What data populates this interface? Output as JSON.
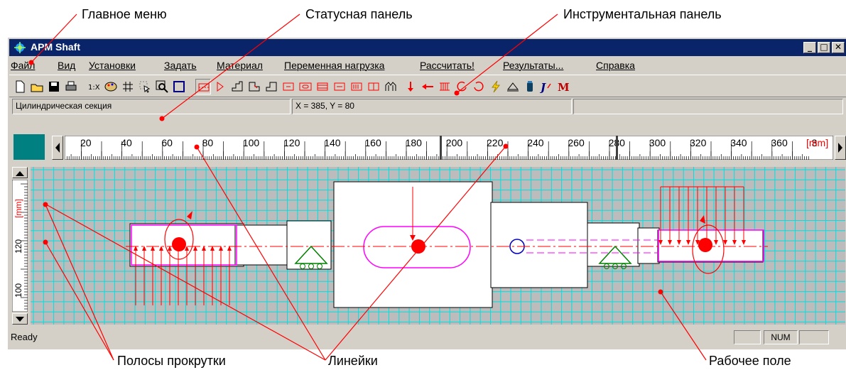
{
  "annotations": {
    "main_menu": "Главное меню",
    "status_panel": "Статусная панель",
    "toolbar": "Инструментальная панель",
    "scrollbars": "Полосы прокрутки",
    "rulers": "Линейки",
    "workspace": "Рабочее поле"
  },
  "window": {
    "title": "APM Shaft"
  },
  "menu": [
    "Файл",
    "Вид",
    "Установки",
    "Задать",
    "Материал",
    "Переменная нагрузка",
    "Рассчитать!",
    "Результаты...",
    "Справка"
  ],
  "toolbar_icons": [
    "new-file-icon",
    "open-folder-icon",
    "save-icon",
    "print-icon",
    "scale-1x-icon",
    "palette-icon",
    "grid-icon",
    "select-cursor-icon",
    "zoom-icon",
    "frame-icon",
    "cylinder-section-icon",
    "cone-section-icon",
    "step-left-icon",
    "step-right-icon",
    "step-both-icon",
    "groove-icon",
    "key-slot-icon",
    "spline-icon",
    "thread-icon",
    "gear-section-icon",
    "ring-icon",
    "pattern-icon",
    "force-down-icon",
    "force-left-icon",
    "distributed-load-icon",
    "moment-ccw-icon",
    "moment-cw-icon",
    "lightning-icon",
    "support-icon",
    "bearing-icon",
    "bending-icon",
    "mass-icon"
  ],
  "status": {
    "section": "Цилиндрическая секция",
    "coords": "X = 385, Y = 80"
  },
  "ruler": {
    "h_labels": [
      "20",
      "40",
      "60",
      "80",
      "100",
      "120",
      "140",
      "160",
      "180",
      "200",
      "220",
      "240",
      "260",
      "280",
      "300",
      "320",
      "340",
      "360",
      "3"
    ],
    "h_unit": "[mm]",
    "v_labels": [
      "120",
      "100"
    ],
    "v_unit": "[mm]"
  },
  "statusbar": {
    "ready": "Ready",
    "num": "NUM"
  },
  "colors": {
    "titlebar": "#0a246a",
    "grid": "#00e0e0",
    "canvas": "#bcbcbc",
    "load": "#ff0000",
    "outline": "#ff00ff",
    "support": "#008000"
  }
}
